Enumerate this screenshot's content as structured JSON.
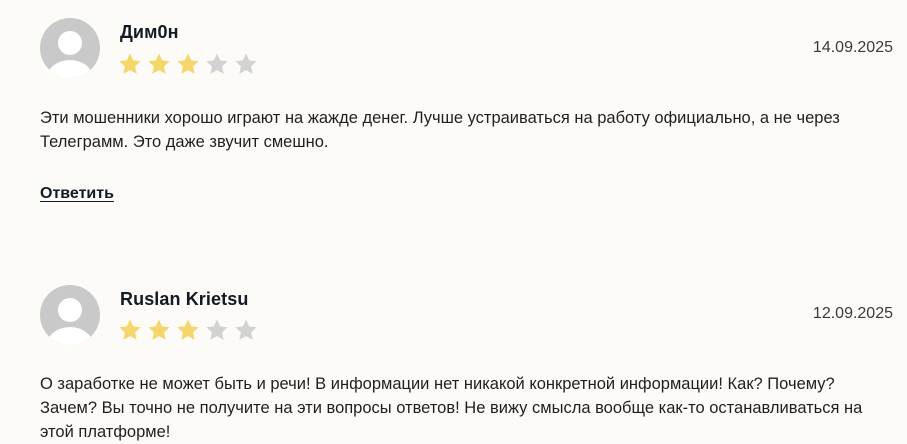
{
  "colors": {
    "star_filled": "#f5d66a",
    "star_empty": "#d2d2d2",
    "avatar_bg": "#c9c9c9",
    "background": "#fdfbf8"
  },
  "reviews": [
    {
      "author": "Дим0н",
      "date": "14.09.2025",
      "rating": 3,
      "rating_max": 5,
      "text": "Эти мошенники хорошо играют на жажде денег. Лучше устраиваться на работу официально, а не через Телеграмм. Это даже звучит смешно.",
      "reply_label": "Ответить",
      "avatar_icon": "user-silhouette-icon"
    },
    {
      "author": "Ruslan Krietsu",
      "date": "12.09.2025",
      "rating": 3,
      "rating_max": 5,
      "text": "О заработке не может быть и речи! В информации нет никакой конкретной информации! Как? Почему? Зачем? Вы точно не получите на эти вопросы ответов! Не вижу смысла вообще как-то останавливаться на этой платформе!",
      "avatar_icon": "user-silhouette-icon"
    }
  ]
}
